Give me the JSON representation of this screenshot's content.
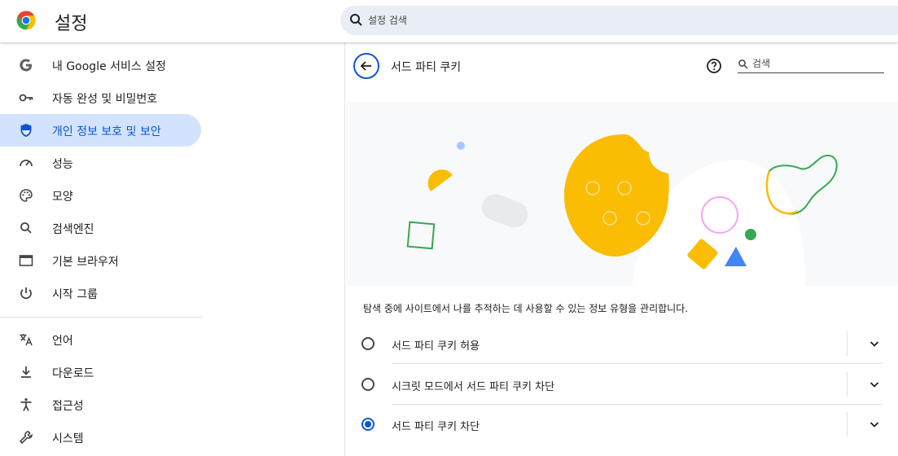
{
  "header": {
    "logo": "chrome-logo",
    "title": "설정",
    "search_placeholder": "설정 검색"
  },
  "sidebar": {
    "items": [
      {
        "label": "내 Google 서비스 설정",
        "icon": "google-g-icon",
        "active": false
      },
      {
        "label": "자동 완성 및 비밀번호",
        "icon": "key-icon",
        "active": false
      },
      {
        "label": "개인 정보 보호 및 보안",
        "icon": "shield-icon",
        "active": true
      },
      {
        "label": "성능",
        "icon": "speedometer-icon",
        "active": false
      },
      {
        "label": "모양",
        "icon": "palette-icon",
        "active": false
      },
      {
        "label": "검색엔진",
        "icon": "search-icon",
        "active": false
      },
      {
        "label": "기본 브라우저",
        "icon": "browser-window-icon",
        "active": false
      },
      {
        "label": "시작 그룹",
        "icon": "power-icon",
        "active": false
      },
      {
        "label": "언어",
        "icon": "translate-icon",
        "active": false
      },
      {
        "label": "다운로드",
        "icon": "download-icon",
        "active": false
      },
      {
        "label": "접근성",
        "icon": "accessibility-icon",
        "active": false
      },
      {
        "label": "시스템",
        "icon": "wrench-icon",
        "active": false
      }
    ]
  },
  "main": {
    "title": "서드 파티 쿠키",
    "search_placeholder": "검색",
    "description": "탐색 중에 사이트에서 나를 추적하는 데 사용할 수 있는 정보 유형을 관리합니다.",
    "options": [
      {
        "label": "서드 파티 쿠키 허용",
        "selected": false
      },
      {
        "label": "시크릿 모드에서 서드 파티 쿠키 차단",
        "selected": false
      },
      {
        "label": "서드 파티 쿠키 차단",
        "selected": true
      }
    ]
  },
  "colors": {
    "accent": "#0b57d0",
    "active_bg": "#d3e3fd",
    "search_bg": "#e9eef6",
    "cookie_yellow": "#fbbc04",
    "green": "#34a853",
    "pink": "#f4a6f0"
  }
}
